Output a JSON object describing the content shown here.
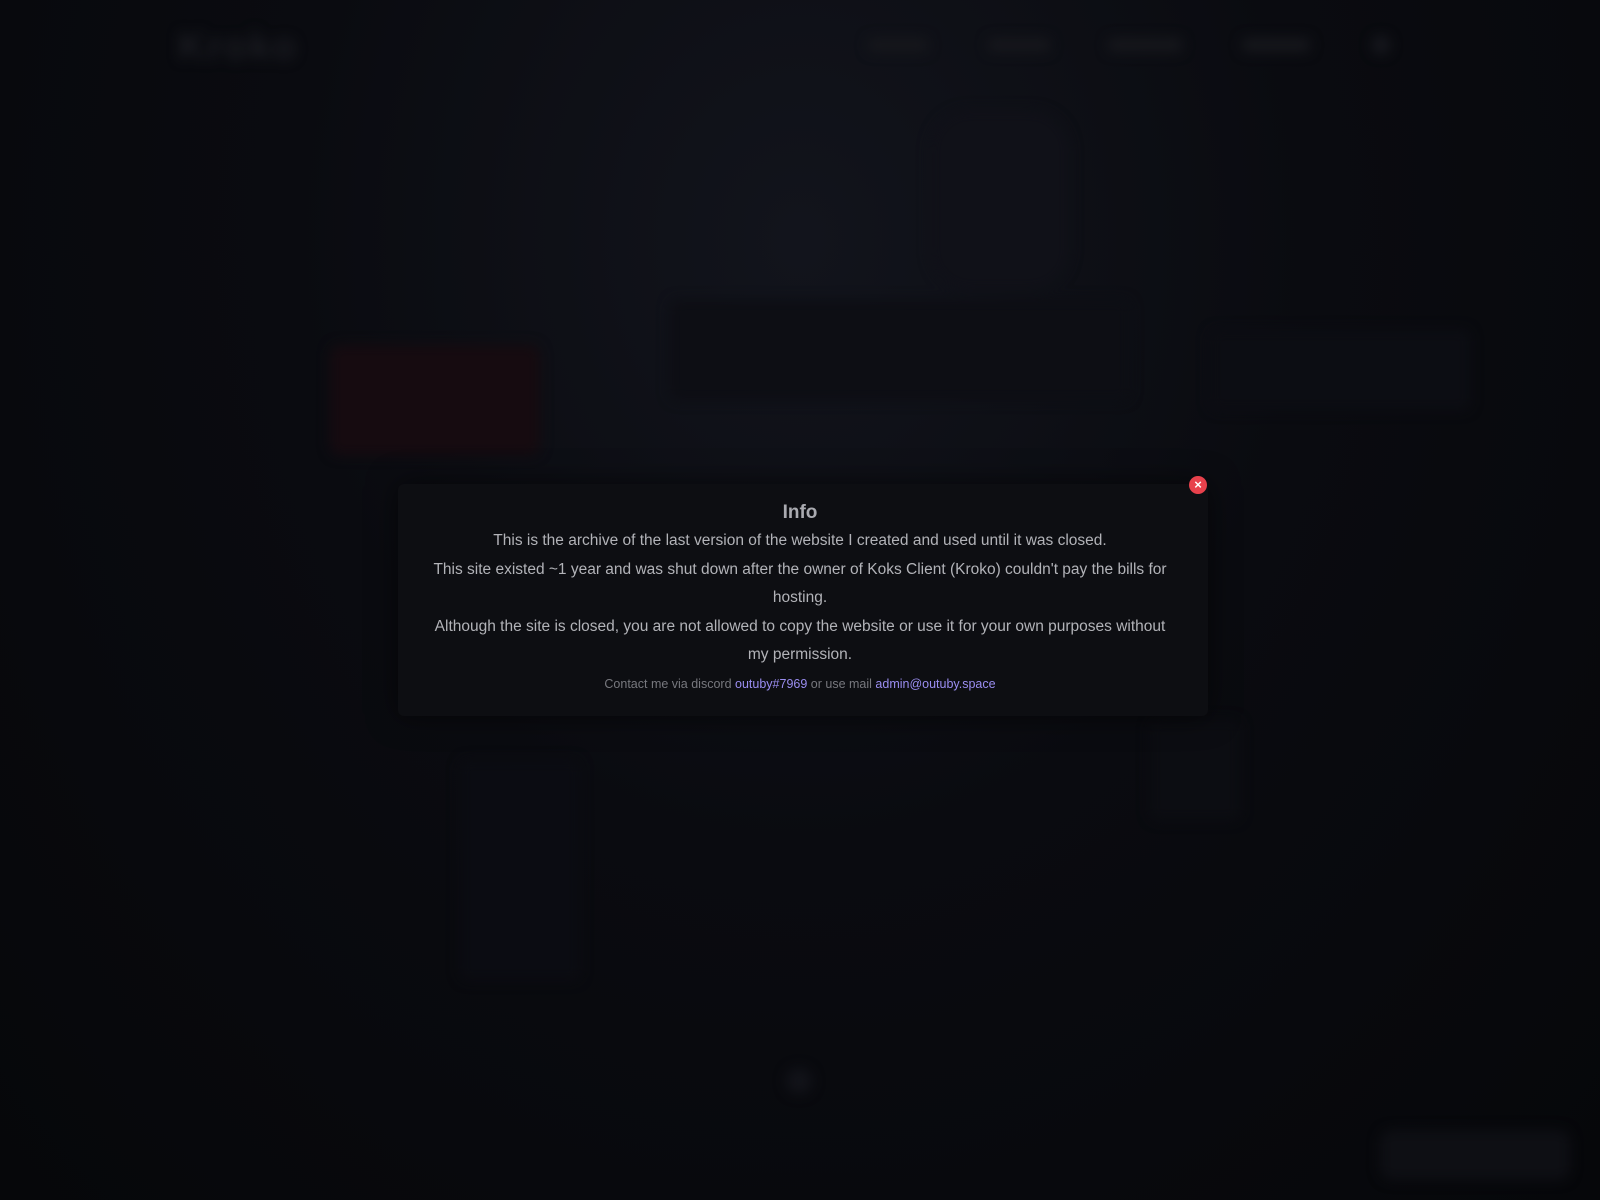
{
  "nav": {
    "logo": "Kroko",
    "links": [
      "",
      "",
      "",
      ""
    ]
  },
  "modal": {
    "title": "Info",
    "paragraphs": [
      "This is the archive of the last version of the website I created and used until it was closed.",
      "This site existed ~1 year and was shut down after the owner of Koks Client (Kroko) couldn't pay the bills for hosting.",
      "Although the site is closed, you are not allowed to copy the website or use it for your own purposes without my permission."
    ],
    "contact": {
      "prefix": "Contact me via discord",
      "discord": "outuby#7969",
      "middle": "or use mail",
      "email": "admin@outuby.space"
    },
    "close_icon": "×"
  },
  "colors": {
    "background": "#07080c",
    "modal_bg": "#0d0e12",
    "close": "#e8414c",
    "link": "#9a8df0"
  }
}
